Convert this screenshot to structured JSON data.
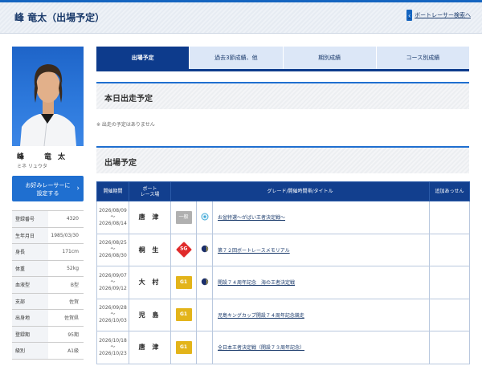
{
  "header": {
    "title": "峰 竜太（出場予定）",
    "back_link": "ボートレーサー検索へ"
  },
  "profile": {
    "name": "峰　竜太",
    "kana": "ミネ リュウタ",
    "favorite_button": "お好みレーサーに\n設定する",
    "attributes": [
      {
        "key": "登録番号",
        "value": "4320"
      },
      {
        "key": "生年月日",
        "value": "1985/03/30"
      },
      {
        "key": "身長",
        "value": "171cm"
      },
      {
        "key": "体重",
        "value": "52kg"
      },
      {
        "key": "血液型",
        "value": "B型"
      },
      {
        "key": "支部",
        "value": "佐賀"
      },
      {
        "key": "出身地",
        "value": "佐賀県"
      },
      {
        "key": "登録期",
        "value": "95期"
      },
      {
        "key": "級別",
        "value": "A1級"
      }
    ]
  },
  "tabs": [
    "出場予定",
    "過去3節成績、他",
    "期別成績",
    "コース別成績"
  ],
  "today_section": {
    "title": "本日出走予定",
    "empty_message": "※ 出走の予定はありません"
  },
  "schedule_section": {
    "title": "出場予定",
    "columns": [
      "開催期間",
      "ボート\nレース場",
      "グレード/開催時間帯/タイトル",
      "追加あっせん"
    ],
    "rows": [
      {
        "start": "2026/08/09",
        "end": "2026/08/14",
        "venue": "唐 津",
        "grade": "一般",
        "grade_type": "ippan",
        "time_icon": "morning-icon",
        "title": "お盆特選～がばい王者決定戦～"
      },
      {
        "start": "2026/08/25",
        "end": "2026/08/30",
        "venue": "桐 生",
        "grade": "SG",
        "grade_type": "sg",
        "time_icon": "night-icon",
        "title": "第７２回ボートレースメモリアル"
      },
      {
        "start": "2026/09/07",
        "end": "2026/09/12",
        "venue": "大 村",
        "grade": "G1",
        "grade_type": "g1",
        "time_icon": "night-icon",
        "title": "開設７４周年記念　海の王者決定戦"
      },
      {
        "start": "2026/09/28",
        "end": "2026/10/03",
        "venue": "児 島",
        "grade": "G1",
        "grade_type": "g1",
        "time_icon": "",
        "title": "児島キングカップ開設７４周年記念競走"
      },
      {
        "start": "2026/10/18",
        "end": "2026/10/23",
        "venue": "唐 津",
        "grade": "G1",
        "grade_type": "g1",
        "time_icon": "",
        "title": "全日本王者決定戦（開設７３周年記念）"
      }
    ]
  },
  "colors": {
    "primary": "#0d3b8c",
    "accent": "#1f6fd0",
    "g1": "#e3b41a",
    "sg": "#e02a2a"
  }
}
